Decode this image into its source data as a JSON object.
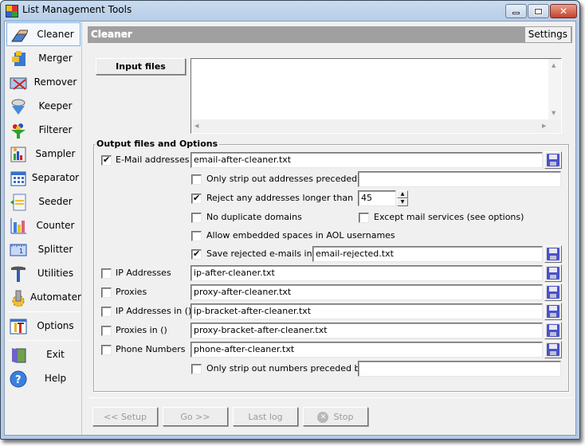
{
  "window": {
    "title": "List Management Tools",
    "controls": {
      "minimize": "minimize",
      "maximize": "maximize",
      "close": "close"
    }
  },
  "sidebar": {
    "items": [
      {
        "label": "Cleaner",
        "icon": "eraser-icon",
        "active": true
      },
      {
        "label": "Merger",
        "icon": "merge-puzzle-icon"
      },
      {
        "label": "Remover",
        "icon": "remove-envelope-icon"
      },
      {
        "label": "Keeper",
        "icon": "keeper-funnel-icon"
      },
      {
        "label": "Filterer",
        "icon": "filter-funnel-icon"
      },
      {
        "label": "Sampler",
        "icon": "sampler-icon"
      },
      {
        "label": "Separator",
        "icon": "grid-calendar-icon"
      },
      {
        "label": "Seeder",
        "icon": "seeder-document-icon"
      },
      {
        "label": "Counter",
        "icon": "bar-chart-icon"
      },
      {
        "label": "Splitter",
        "icon": "ruler-icon"
      },
      {
        "label": "Utilities",
        "icon": "hammer-icon"
      },
      {
        "label": "Automater",
        "icon": "gear-cylinder-icon"
      },
      {
        "label": "Options",
        "icon": "tools-icon"
      },
      {
        "label": "Exit",
        "icon": "door-exit-icon"
      },
      {
        "label": "Help",
        "icon": "help-question-icon"
      }
    ]
  },
  "header": {
    "title": "Cleaner",
    "settings_label": "Settings"
  },
  "input": {
    "button_label": "Input files",
    "files": []
  },
  "output": {
    "group_label": "Output files and Options",
    "email": {
      "label": "E-Mail addresses",
      "checked": true,
      "file": "email-after-cleaner.txt"
    },
    "email_options": {
      "strip_preceded": {
        "label": "Only strip out addresses preceded by",
        "checked": false,
        "value": ""
      },
      "reject_longer": {
        "label": "Reject any addresses longer than",
        "checked": true,
        "value": "45"
      },
      "no_dup_domains": {
        "label": "No duplicate domains",
        "checked": false
      },
      "except_mail_services": {
        "label": "Except mail services (see options)",
        "checked": false
      },
      "allow_aol_spaces": {
        "label": "Allow embedded spaces in AOL usernames",
        "checked": false
      },
      "save_rejected": {
        "label": "Save rejected e-mails into",
        "checked": true,
        "file": "email-rejected.txt"
      }
    },
    "ip": {
      "label": "IP Addresses",
      "checked": false,
      "file": "ip-after-cleaner.txt"
    },
    "proxies": {
      "label": "Proxies",
      "checked": false,
      "file": "proxy-after-cleaner.txt"
    },
    "ip_bracket": {
      "label": "IP Addresses in ()",
      "checked": false,
      "file": "ip-bracket-after-cleaner.txt"
    },
    "proxies_bracket": {
      "label": "Proxies in ()",
      "checked": false,
      "file": "proxy-bracket-after-cleaner.txt"
    },
    "phone": {
      "label": "Phone Numbers",
      "checked": false,
      "file": "phone-after-cleaner.txt"
    },
    "phone_options": {
      "strip_preceded": {
        "label": "Only strip out numbers preceded by",
        "checked": false,
        "value": ""
      }
    }
  },
  "footer": {
    "setup_label": "<< Setup",
    "go_label": "Go >>",
    "lastlog_label": "Last log",
    "stop_label": "Stop"
  },
  "colors": {
    "header_bg": "#a0a0a0",
    "active_border": "#7eb4ea",
    "save_icon": "#4a52c8"
  }
}
